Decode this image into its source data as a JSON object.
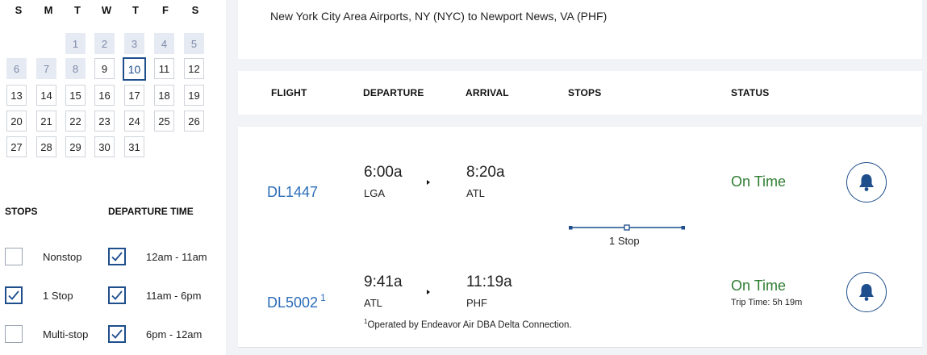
{
  "calendar": {
    "weekdays": [
      "S",
      "M",
      "T",
      "W",
      "T",
      "F",
      "S"
    ],
    "past_days": [
      "1",
      "2",
      "3",
      "4",
      "5",
      "6",
      "7",
      "8"
    ],
    "selected_day": "10",
    "days": [
      "9",
      "11",
      "12",
      "13",
      "14",
      "15",
      "16",
      "17",
      "18",
      "19",
      "20",
      "21",
      "22",
      "23",
      "24",
      "25",
      "26",
      "27",
      "28",
      "29",
      "30",
      "31"
    ]
  },
  "filters": {
    "stops_heading": "STOPS",
    "departure_heading": "DEPARTURE TIME",
    "stops": [
      {
        "label": "Nonstop",
        "checked": false
      },
      {
        "label": "1 Stop",
        "checked": true
      },
      {
        "label": "Multi-stop",
        "checked": false
      }
    ],
    "departure_times": [
      {
        "label": "12am - 11am",
        "checked": true
      },
      {
        "label": "11am - 6pm",
        "checked": true
      },
      {
        "label": "6pm - 12am",
        "checked": true
      }
    ]
  },
  "route": "New York City Area Airports, NY (NYC) to Newport News, VA (PHF)",
  "columns": [
    "FLIGHT",
    "DEPARTURE",
    "ARRIVAL",
    "STOPS",
    "STATUS"
  ],
  "trip": {
    "stops_label": "1 Stop",
    "trip_time": "Trip Time: 5h 19m",
    "footnote_mark": "1",
    "footnote": "Operated by Endeavor Air DBA Delta Connection.",
    "segments": [
      {
        "flight": "DL1447",
        "footnote_ref": "",
        "dep_time": "6:00a",
        "dep_airport": "LGA",
        "arr_time": "8:20a",
        "arr_airport": "ATL",
        "status": "On Time"
      },
      {
        "flight": "DL5002",
        "footnote_ref": "1",
        "dep_time": "9:41a",
        "dep_airport": "ATL",
        "arr_time": "11:19a",
        "arr_airport": "PHF",
        "status": "On Time"
      }
    ]
  },
  "colors": {
    "accent": "#1f4e8c",
    "link": "#2c6db8",
    "on_time": "#2e7d32",
    "past_day_bg": "#e6ebf3"
  },
  "icons": {
    "notify": "bell-icon",
    "checkbox": "check-icon",
    "direction": "caret-right-icon"
  }
}
